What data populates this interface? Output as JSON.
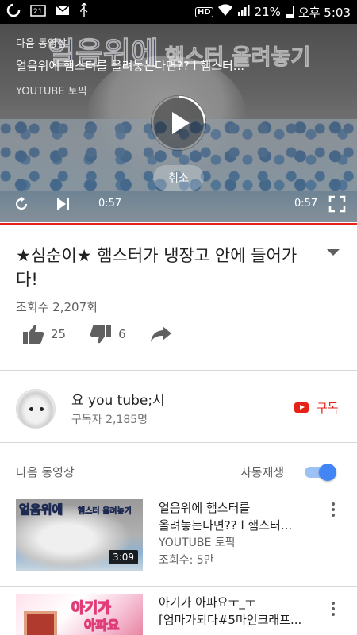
{
  "status_bar": {
    "hd": "HD",
    "battery": "21%",
    "time": "오후 5:03"
  },
  "player": {
    "up_next_label": "다음 동영상",
    "overlay_text": "얼음위에",
    "overlay_text_2": "햄스터 올려놓기",
    "next_title": "얼음위에 햄스터를 올려놓는다면?? l 햄스터...",
    "next_channel": "YOUTUBE 토픽",
    "cancel_label": "취소",
    "current_time": "0:57",
    "total_time": "0:57",
    "progress": 1.0,
    "accent_color": "#e62117"
  },
  "video": {
    "title": "★심순이★ 햄스터가 냉장고 안에 들어가다!",
    "views": "조회수 2,207회",
    "likes": "25",
    "dislikes": "6"
  },
  "channel": {
    "name": "요 you tube;시",
    "subscribers": "구독자 2,185명",
    "subscribe_label": "구독"
  },
  "up_next": {
    "label": "다음 동영상",
    "autoplay_label": "자동재생",
    "autoplay_on": true,
    "toggle_color": "#4285f4",
    "items": [
      {
        "title_line1": "얼음위에 햄스터를",
        "title_line2": "올려놓는다면?? l 햄스터...",
        "channel": "YOUTUBE 토픽",
        "views": "조회수: 5만",
        "duration": "3:09",
        "thumb_text": "얼음위에",
        "thumb_text_2": "햄스터 올려놓기"
      },
      {
        "title_line1": "아기가 아파요ㅜ_ㅜ",
        "title_line2": "[엄마가되다#5마인크래프...",
        "channel": "",
        "views": "",
        "duration": "",
        "thumb_text": "아기가",
        "thumb_text_2": "아파요"
      }
    ]
  }
}
